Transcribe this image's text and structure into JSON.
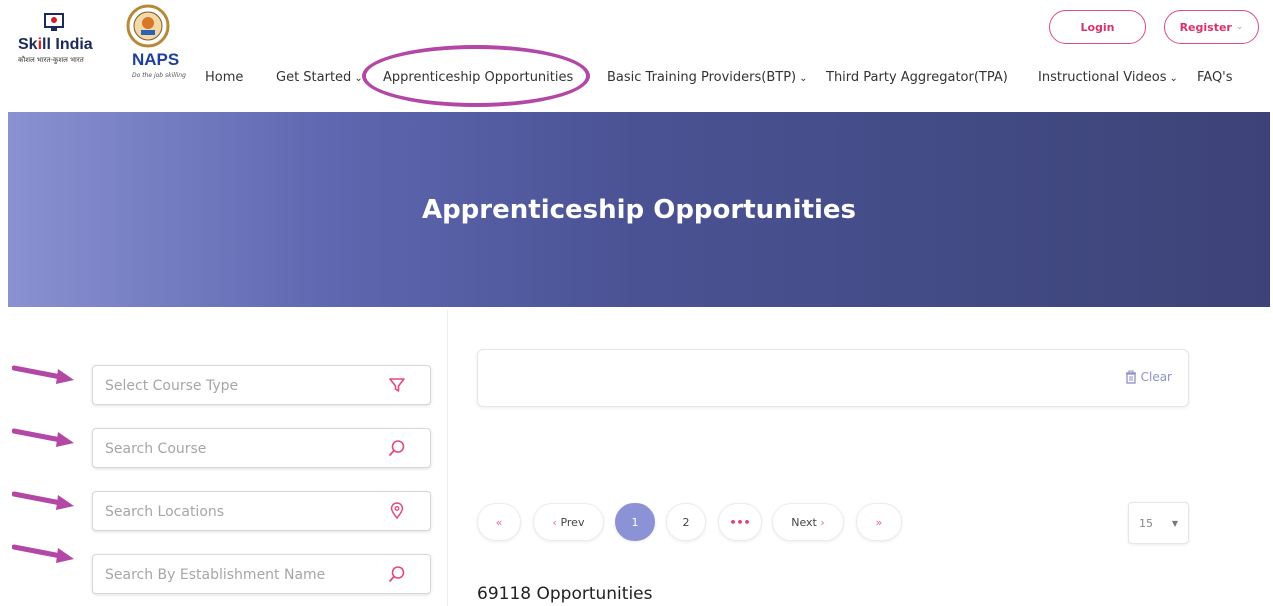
{
  "header": {
    "skill_logo": {
      "title_left": "Sk",
      "title_red": "i",
      "title_right": "ll India",
      "tagline": "कौशल भारत-कुशल भारत"
    },
    "naps_logo": {
      "name": "NAPS",
      "motto": "Do the job skilling"
    },
    "nav": [
      {
        "label": "Home"
      },
      {
        "label": "Get Started",
        "dropdown": true
      },
      {
        "label": "Apprenticeship Opportunities",
        "highlighted": true
      },
      {
        "label": "Basic Training Providers(BTP)",
        "dropdown": true
      },
      {
        "label": "Third Party Aggregator(TPA)"
      },
      {
        "label": "Instructional Videos",
        "dropdown": true
      },
      {
        "label": "FAQ's"
      }
    ],
    "login_label": "Login",
    "register_label": "Register"
  },
  "banner": {
    "title": "Apprenticeship Opportunities"
  },
  "filters": {
    "course_type_placeholder": "Select Course Type",
    "course_placeholder": "Search Course",
    "locations_placeholder": "Search Locations",
    "establishment_placeholder": "Search By Establishment Name"
  },
  "results": {
    "clear_label": "Clear",
    "pagination": {
      "first": "«",
      "prev": "Prev",
      "pages": [
        "1",
        "2"
      ],
      "ellipsis": "•••",
      "next": "Next",
      "last": "»",
      "current_page": 1
    },
    "per_page": "15",
    "count_text": "69118 Opportunities"
  },
  "colors": {
    "accent_pink": "#e04b7b",
    "annotation_purple": "#b347a6",
    "active_page": "#8b92d6",
    "banner_dark": "#3d4378"
  },
  "icons": [
    "filter-icon",
    "search-icon",
    "location-pin-icon",
    "trash-icon",
    "chevron-down-icon",
    "arrow-right-icon"
  ]
}
